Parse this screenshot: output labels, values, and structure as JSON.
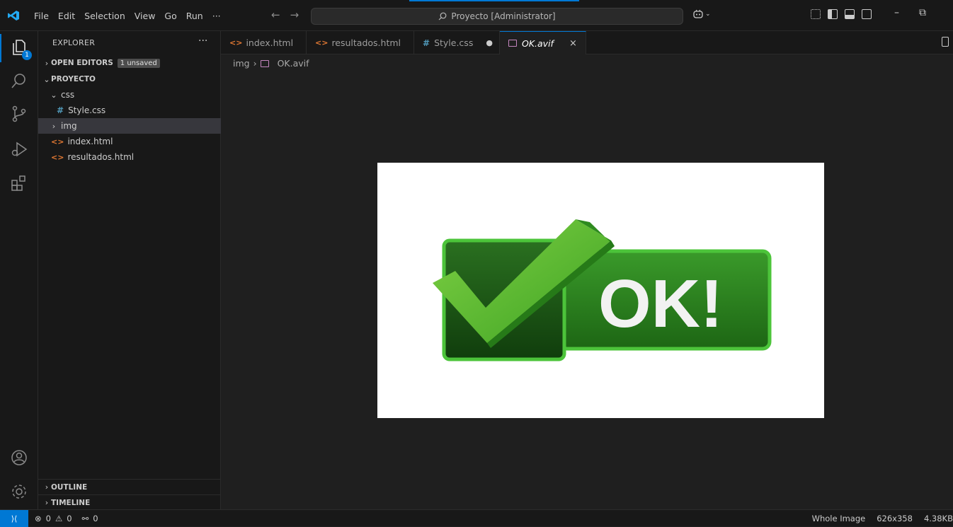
{
  "titlebar": {
    "menu": [
      "File",
      "Edit",
      "Selection",
      "View",
      "Go",
      "Run",
      "···"
    ],
    "search": "Proyecto [Administrator]"
  },
  "activity": {
    "explorer_badge": "1"
  },
  "sidebar": {
    "header": "EXPLORER",
    "more": "···",
    "open_editors": "OPEN EDITORS",
    "unsaved_badge": "1 unsaved",
    "project": "PROYECTO",
    "tree": {
      "css_folder": "css",
      "style_css": "Style.css",
      "img_folder": "img",
      "index_html": "index.html",
      "resultados_html": "resultados.html"
    },
    "outline": "OUTLINE",
    "timeline": "TIMELINE"
  },
  "tabs": [
    {
      "label": "index.html"
    },
    {
      "label": "resultados.html"
    },
    {
      "label": "Style.css"
    },
    {
      "label": "OK.avif"
    }
  ],
  "breadcrumb": {
    "folder": "img",
    "file": "OK.avif"
  },
  "image": {
    "text": "OK!"
  },
  "status": {
    "errors": "0",
    "warnings": "0",
    "ports": "0",
    "zoom": "Whole Image",
    "dimensions": "626x358",
    "size": "4.38KB"
  },
  "colors": {
    "accent": "#0078d4",
    "bg": "#1f1f1f",
    "sidebar_bg": "#181818",
    "ok_green": "#2e8b1f"
  }
}
